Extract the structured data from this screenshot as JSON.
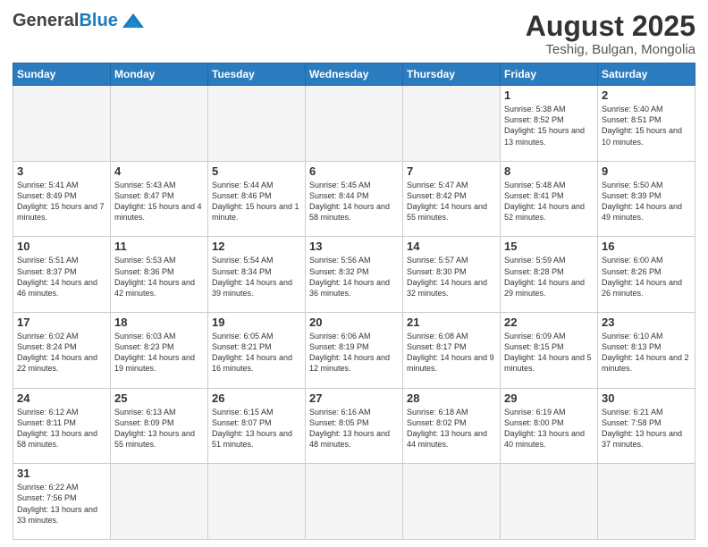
{
  "logo": {
    "general": "General",
    "blue": "Blue"
  },
  "header": {
    "month": "August 2025",
    "location": "Teshig, Bulgan, Mongolia"
  },
  "weekdays": [
    "Sunday",
    "Monday",
    "Tuesday",
    "Wednesday",
    "Thursday",
    "Friday",
    "Saturday"
  ],
  "weeks": [
    [
      {
        "day": "",
        "info": ""
      },
      {
        "day": "",
        "info": ""
      },
      {
        "day": "",
        "info": ""
      },
      {
        "day": "",
        "info": ""
      },
      {
        "day": "",
        "info": ""
      },
      {
        "day": "1",
        "info": "Sunrise: 5:38 AM\nSunset: 8:52 PM\nDaylight: 15 hours and 13 minutes."
      },
      {
        "day": "2",
        "info": "Sunrise: 5:40 AM\nSunset: 8:51 PM\nDaylight: 15 hours and 10 minutes."
      }
    ],
    [
      {
        "day": "3",
        "info": "Sunrise: 5:41 AM\nSunset: 8:49 PM\nDaylight: 15 hours and 7 minutes."
      },
      {
        "day": "4",
        "info": "Sunrise: 5:43 AM\nSunset: 8:47 PM\nDaylight: 15 hours and 4 minutes."
      },
      {
        "day": "5",
        "info": "Sunrise: 5:44 AM\nSunset: 8:46 PM\nDaylight: 15 hours and 1 minute."
      },
      {
        "day": "6",
        "info": "Sunrise: 5:45 AM\nSunset: 8:44 PM\nDaylight: 14 hours and 58 minutes."
      },
      {
        "day": "7",
        "info": "Sunrise: 5:47 AM\nSunset: 8:42 PM\nDaylight: 14 hours and 55 minutes."
      },
      {
        "day": "8",
        "info": "Sunrise: 5:48 AM\nSunset: 8:41 PM\nDaylight: 14 hours and 52 minutes."
      },
      {
        "day": "9",
        "info": "Sunrise: 5:50 AM\nSunset: 8:39 PM\nDaylight: 14 hours and 49 minutes."
      }
    ],
    [
      {
        "day": "10",
        "info": "Sunrise: 5:51 AM\nSunset: 8:37 PM\nDaylight: 14 hours and 46 minutes."
      },
      {
        "day": "11",
        "info": "Sunrise: 5:53 AM\nSunset: 8:36 PM\nDaylight: 14 hours and 42 minutes."
      },
      {
        "day": "12",
        "info": "Sunrise: 5:54 AM\nSunset: 8:34 PM\nDaylight: 14 hours and 39 minutes."
      },
      {
        "day": "13",
        "info": "Sunrise: 5:56 AM\nSunset: 8:32 PM\nDaylight: 14 hours and 36 minutes."
      },
      {
        "day": "14",
        "info": "Sunrise: 5:57 AM\nSunset: 8:30 PM\nDaylight: 14 hours and 32 minutes."
      },
      {
        "day": "15",
        "info": "Sunrise: 5:59 AM\nSunset: 8:28 PM\nDaylight: 14 hours and 29 minutes."
      },
      {
        "day": "16",
        "info": "Sunrise: 6:00 AM\nSunset: 8:26 PM\nDaylight: 14 hours and 26 minutes."
      }
    ],
    [
      {
        "day": "17",
        "info": "Sunrise: 6:02 AM\nSunset: 8:24 PM\nDaylight: 14 hours and 22 minutes."
      },
      {
        "day": "18",
        "info": "Sunrise: 6:03 AM\nSunset: 8:23 PM\nDaylight: 14 hours and 19 minutes."
      },
      {
        "day": "19",
        "info": "Sunrise: 6:05 AM\nSunset: 8:21 PM\nDaylight: 14 hours and 16 minutes."
      },
      {
        "day": "20",
        "info": "Sunrise: 6:06 AM\nSunset: 8:19 PM\nDaylight: 14 hours and 12 minutes."
      },
      {
        "day": "21",
        "info": "Sunrise: 6:08 AM\nSunset: 8:17 PM\nDaylight: 14 hours and 9 minutes."
      },
      {
        "day": "22",
        "info": "Sunrise: 6:09 AM\nSunset: 8:15 PM\nDaylight: 14 hours and 5 minutes."
      },
      {
        "day": "23",
        "info": "Sunrise: 6:10 AM\nSunset: 8:13 PM\nDaylight: 14 hours and 2 minutes."
      }
    ],
    [
      {
        "day": "24",
        "info": "Sunrise: 6:12 AM\nSunset: 8:11 PM\nDaylight: 13 hours and 58 minutes."
      },
      {
        "day": "25",
        "info": "Sunrise: 6:13 AM\nSunset: 8:09 PM\nDaylight: 13 hours and 55 minutes."
      },
      {
        "day": "26",
        "info": "Sunrise: 6:15 AM\nSunset: 8:07 PM\nDaylight: 13 hours and 51 minutes."
      },
      {
        "day": "27",
        "info": "Sunrise: 6:16 AM\nSunset: 8:05 PM\nDaylight: 13 hours and 48 minutes."
      },
      {
        "day": "28",
        "info": "Sunrise: 6:18 AM\nSunset: 8:02 PM\nDaylight: 13 hours and 44 minutes."
      },
      {
        "day": "29",
        "info": "Sunrise: 6:19 AM\nSunset: 8:00 PM\nDaylight: 13 hours and 40 minutes."
      },
      {
        "day": "30",
        "info": "Sunrise: 6:21 AM\nSunset: 7:58 PM\nDaylight: 13 hours and 37 minutes."
      }
    ],
    [
      {
        "day": "31",
        "info": "Sunrise: 6:22 AM\nSunset: 7:56 PM\nDaylight: 13 hours and 33 minutes."
      },
      {
        "day": "",
        "info": ""
      },
      {
        "day": "",
        "info": ""
      },
      {
        "day": "",
        "info": ""
      },
      {
        "day": "",
        "info": ""
      },
      {
        "day": "",
        "info": ""
      },
      {
        "day": "",
        "info": ""
      }
    ]
  ]
}
